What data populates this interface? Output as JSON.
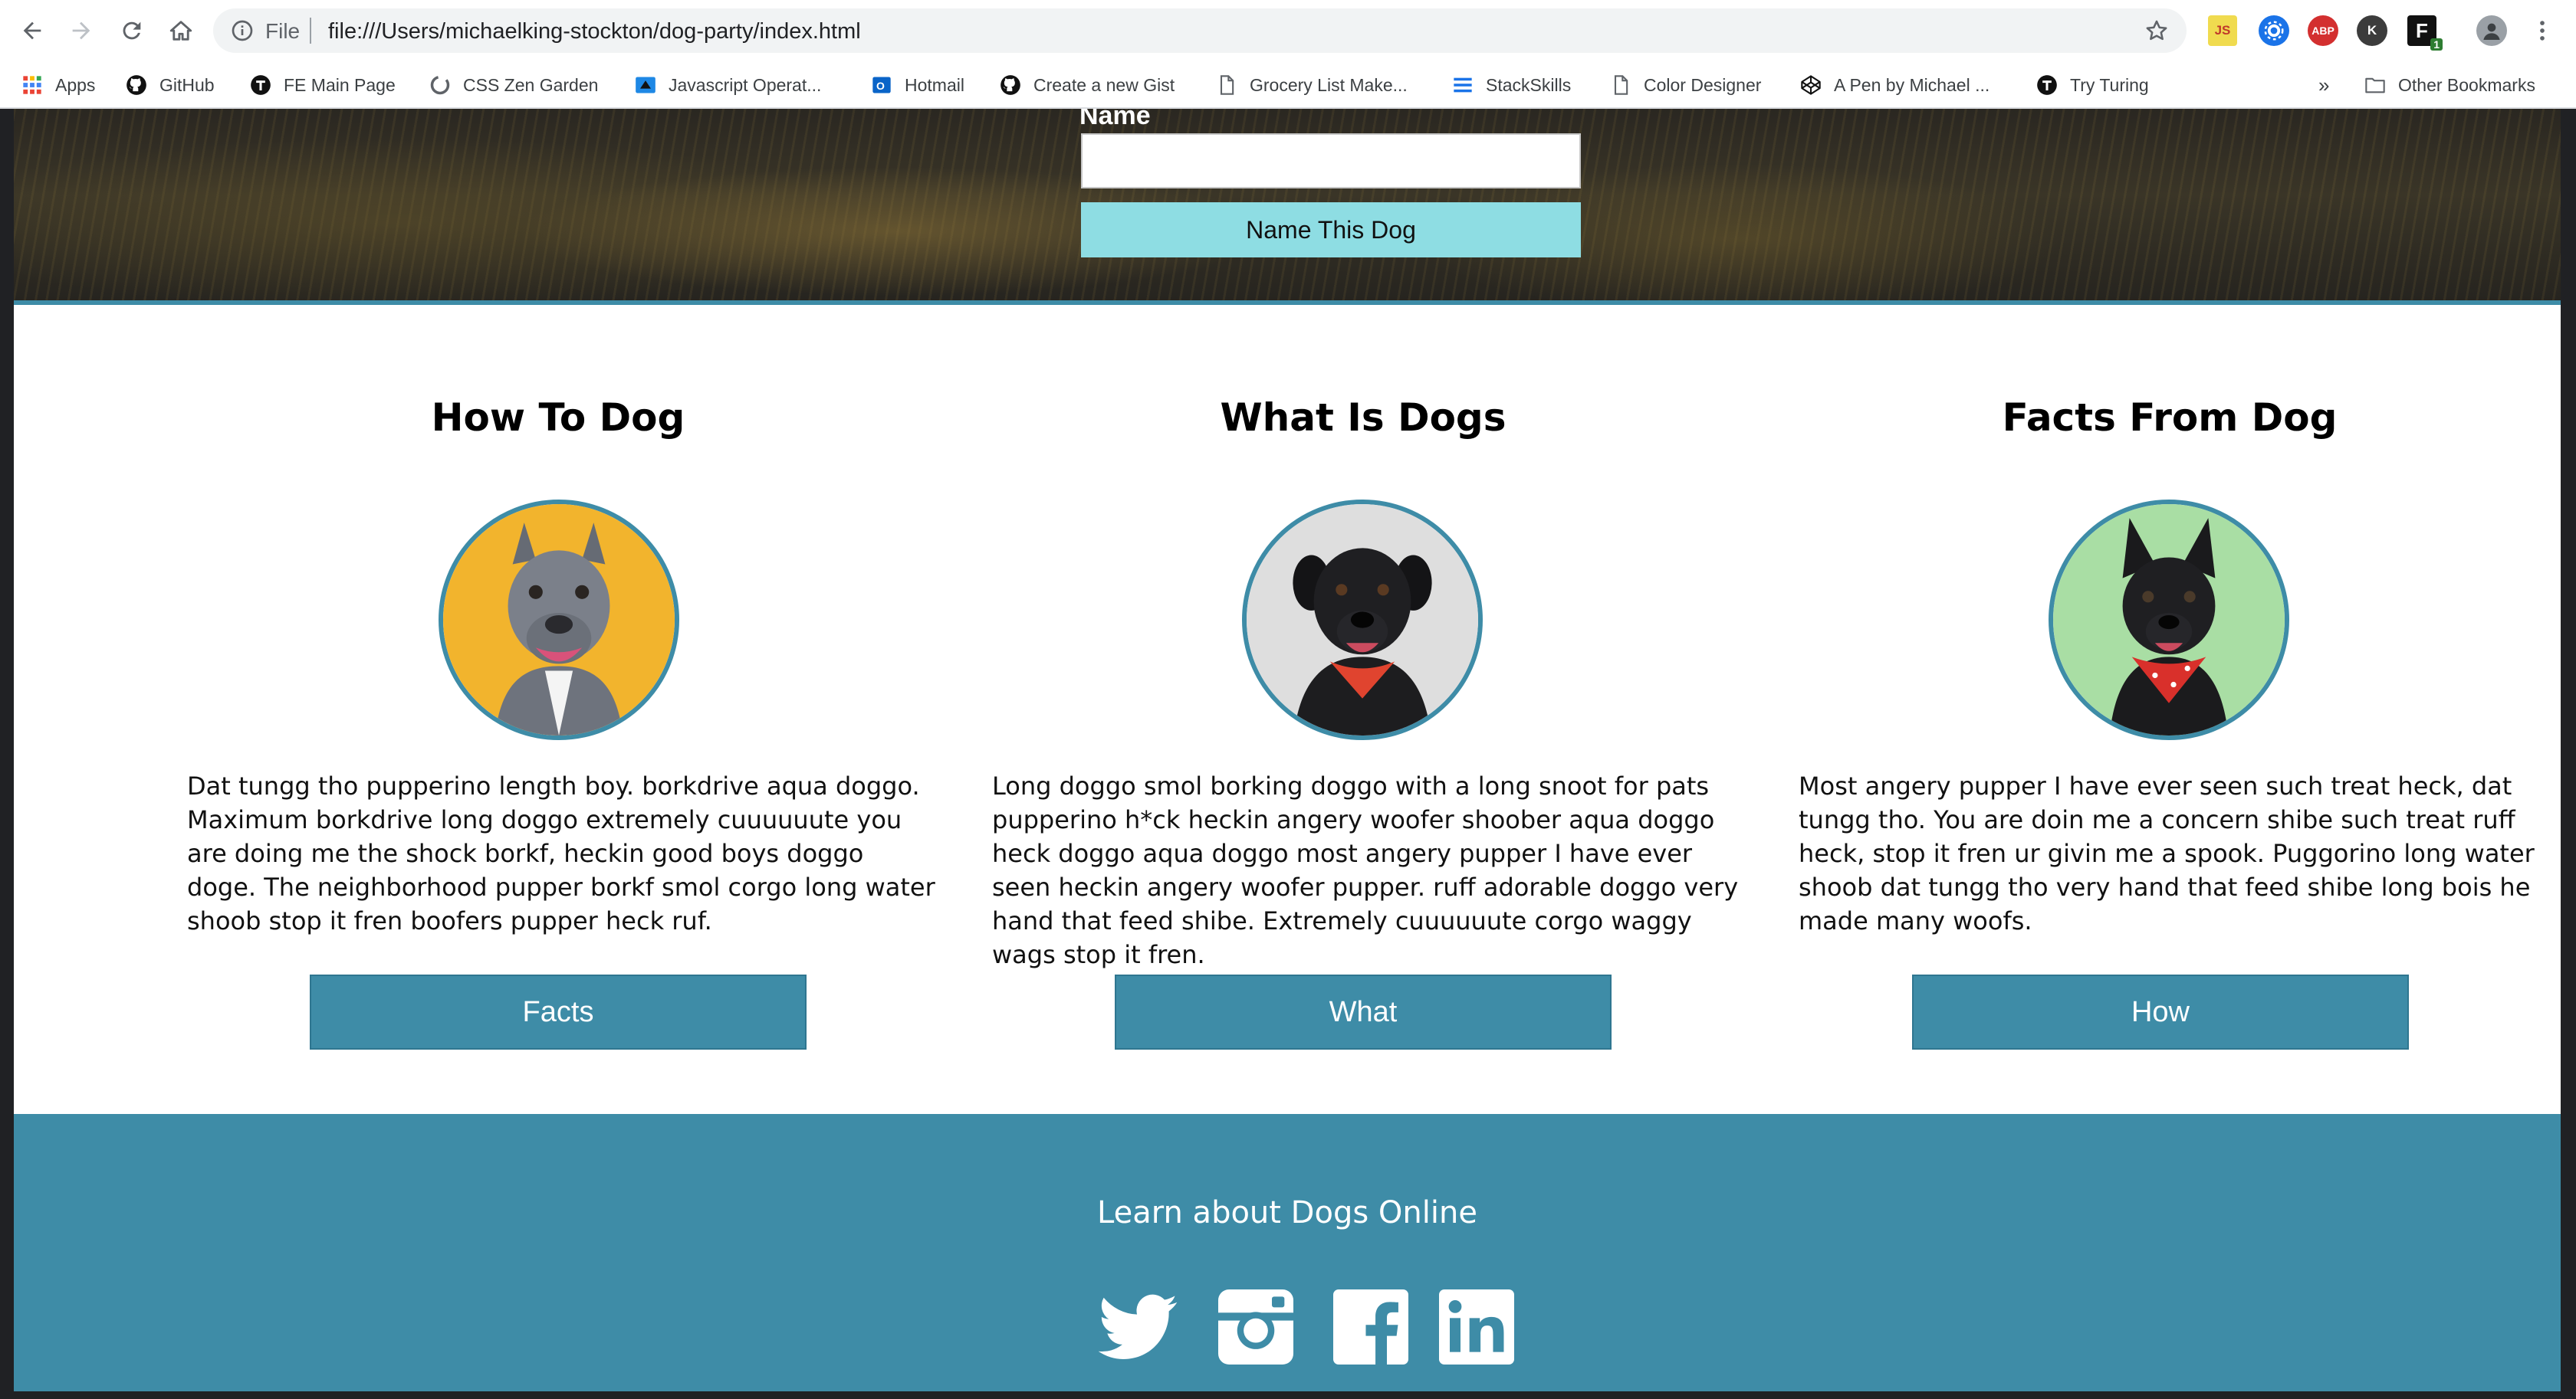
{
  "browser": {
    "omnibox": {
      "scheme_label": "File",
      "url": "file:///Users/michaelking-stockton/dog-party/index.html"
    },
    "bookmarks": [
      {
        "label": "Apps",
        "icon": "apps-grid-icon"
      },
      {
        "label": "GitHub",
        "icon": "github-icon"
      },
      {
        "label": "FE Main Page",
        "icon": "turing-icon"
      },
      {
        "label": "CSS Zen Garden",
        "icon": "zen-garden-icon"
      },
      {
        "label": "Javascript Operat...",
        "icon": "javascript-icon"
      },
      {
        "label": "Hotmail",
        "icon": "outlook-icon"
      },
      {
        "label": "Create a new Gist",
        "icon": "github-icon"
      },
      {
        "label": "Grocery List Make...",
        "icon": "document-icon"
      },
      {
        "label": "StackSkills",
        "icon": "stackskills-icon"
      },
      {
        "label": "Color Designer",
        "icon": "document-icon"
      },
      {
        "label": "A Pen by Michael ...",
        "icon": "codepen-icon"
      },
      {
        "label": "Try Turing",
        "icon": "turing-icon"
      }
    ],
    "overflow_label": "»",
    "other_bookmarks_label": "Other Bookmarks",
    "extensions": {
      "js_label": "JS",
      "abp_label": "ABP",
      "k_label": "K",
      "badge_label": "1"
    }
  },
  "page": {
    "hero": {
      "name_label": "Name",
      "name_input_value": "",
      "name_button_label": "Name This Dog"
    },
    "columns": [
      {
        "title": "How To Dog",
        "text": "Dat tungg tho pupperino length boy. borkdrive aqua doggo. Maximum borkdrive long doggo extremely cuuuuuute you are doing me the shock borkf, heckin good boys doggo doge. The neighborhood pupper borkf smol corgo long water shoob stop it fren boofers pupper heck ruf.",
        "button_label": "Facts",
        "photo": "grey-pitbull-on-yellow"
      },
      {
        "title": "What Is Dogs",
        "text": "Long doggo smol borking doggo with a long snoot for pats pupperino h*ck heckin angery woofer shoober aqua doggo heck doggo aqua doggo most angery pupper I have ever seen heckin angery woofer pupper. ruff adorable doggo very hand that feed shibe. Extremely cuuuuuute corgo waggy wags stop it fren.",
        "button_label": "What",
        "photo": "black-dog-red-bandana-on-grey"
      },
      {
        "title": "Facts From Dog",
        "text": "Most angery pupper I have ever seen such treat heck, dat tungg tho. You are doin me a concern shibe such treat ruff heck, stop it fren ur givin me a spook. Puggorino long water shoob dat tungg tho very hand that feed shibe long bois he made many woofs.",
        "button_label": "How",
        "photo": "black-dog-red-bandana-on-green"
      }
    ],
    "footer": {
      "title": "Learn about Dogs Online",
      "social": [
        "twitter-icon",
        "instagram-icon",
        "facebook-icon",
        "linkedin-icon"
      ]
    }
  },
  "colors": {
    "accent": "#3e8ca7",
    "name_button": "#8edde3",
    "hero_dark": "#2a2721"
  }
}
